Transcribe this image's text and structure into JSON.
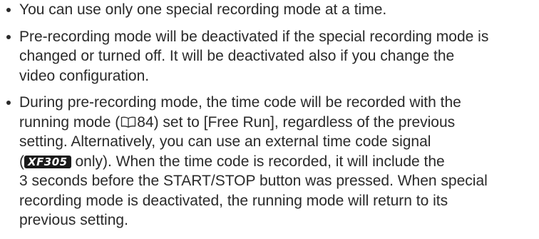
{
  "notes": [
    {
      "lines": [
        "You can use only one special recording mode at a time."
      ]
    },
    {
      "lines": [
        "Pre-recording mode will be deactivated if the special recording mode is",
        "changed or turned off. It will be deactivated also if you change the",
        "video configuration."
      ]
    },
    {
      "line1": "During pre-recording mode, the time code will be recorded with the",
      "line2_before": "running mode (",
      "line2_page_ref": "84",
      "line2_after": ") set to [Free Run], regardless of the previous",
      "line3": "setting. Alternatively, you can use an external time code signal",
      "line4_open": "(",
      "model_badge": "XF305",
      "line4_after": " only). When the time code is recorded, it will include the",
      "line5": "3 seconds before the START/STOP button was pressed. When special",
      "line6": "recording mode is deactivated, the running mode will return to its",
      "line7": "previous setting."
    }
  ],
  "icons": {
    "page_reference": "book-icon"
  }
}
